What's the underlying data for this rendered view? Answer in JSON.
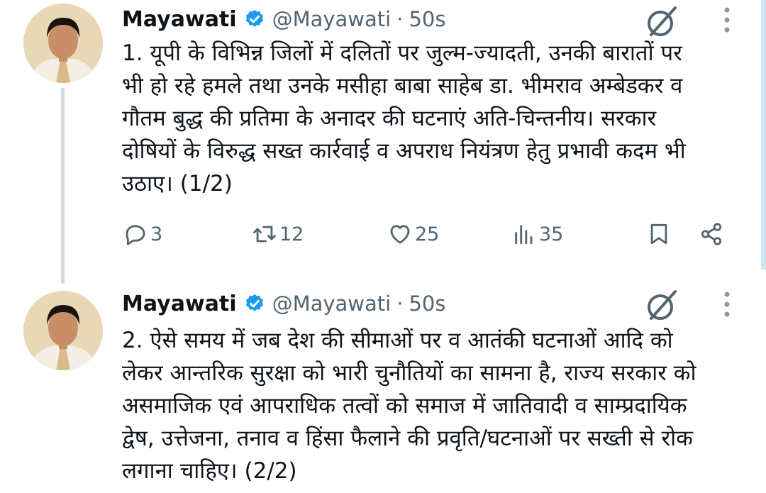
{
  "tweets": [
    {
      "author": {
        "name": "Mayawati",
        "handle": "@Mayawati",
        "verified": true
      },
      "separator": "·",
      "time": "50s",
      "text": "1. यूपी के विभिन्न जिलों में दलितों पर जुल्म-ज्यादती, उनकी बारातों पर\nभी हो रहे हमले तथा उनके मसीहा बाबा साहेब डा. भीमराव अम्बेडकर व\nगौतम बुद्ध की प्रतिमा के अनादर की घटनाएं अति-चिन्तनीय। सरकार\nदोषियों के विरुद्ध सख्त कार्रवाई व अपराध नियंत्रण हेतु प्रभावी कदम भी\nउठाए। (1/2)",
      "metrics": {
        "replies": "3",
        "reposts": "12",
        "likes": "25",
        "views": "35"
      }
    },
    {
      "author": {
        "name": "Mayawati",
        "handle": "@Mayawati",
        "verified": true
      },
      "separator": "·",
      "time": "50s",
      "text": "2. ऐसे समय में जब देश की सीमाओं पर व आतंकी घटनाओं आदि को\nलेकर आन्तरिक सुरक्षा को भारी चुनौतियों का सामना है, राज्य सरकार को\nअसमाजिक एवं आपराधिक तत्वों को समाज में जातिवादी व साम्प्रदायिक\nद्वेष, उत्तेजना, तनाव व हिंसा फैलाने की प्रवृति/घटनाओं पर सख्ती से रोक\nलगाना चाहिए। (2/2)"
    }
  ],
  "icons": {
    "verified": "verified-badge-icon",
    "grok": "grok-icon",
    "more": "more-vertical-icon",
    "reply": "reply-icon",
    "repost": "repost-icon",
    "like": "heart-icon",
    "views": "views-icon",
    "bookmark": "bookmark-icon",
    "share": "share-icon"
  },
  "colors": {
    "primary_text": "#0f1419",
    "secondary_text": "#536471",
    "verified_blue": "#1d9bf0",
    "thread_line": "#cfd9de"
  }
}
